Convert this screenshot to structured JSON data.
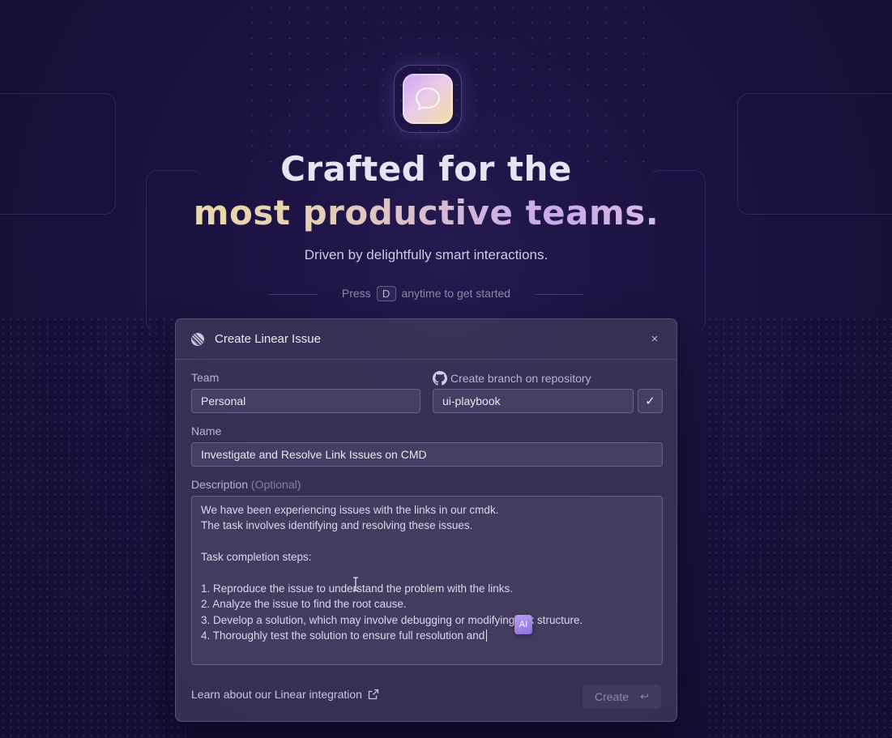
{
  "hero": {
    "title_line1": "Crafted for the",
    "title_line2": "most productive teams.",
    "subtitle": "Driven by delightfully smart interactions.",
    "press_prefix": "Press",
    "press_key": "D",
    "press_suffix": "anytime to get started"
  },
  "dialog": {
    "title": "Create Linear Issue",
    "close_glyph": "×",
    "team": {
      "label": "Team",
      "value": "Personal"
    },
    "repo": {
      "label": "Create branch on repository",
      "value": "ui-playbook",
      "checked": true,
      "check_glyph": "✓"
    },
    "name": {
      "label": "Name",
      "value": "Investigate and Resolve Link Issues on CMD"
    },
    "description": {
      "label": "Description",
      "optional": "(Optional)",
      "lines": [
        "We have been experiencing issues with the links in our cmdk.",
        "The task involves identifying and resolving these issues.",
        "",
        "Task completion steps:",
        "",
        "1. Reproduce the issue to understand the problem with the links.",
        "2. Analyze the issue to find the root cause.",
        "3. Develop a solution, which may involve debugging or modifying link structure.",
        "4. Thoroughly test the solution to ensure full resolution and"
      ]
    },
    "ai_badge": "AI",
    "footer_link": "Learn about our Linear integration",
    "create_label": "Create",
    "create_shortcut": "↩"
  },
  "colors": {
    "background": "#1a1240",
    "dialog_bg": "#3c3458",
    "accent_gradient_start": "#efe1a8",
    "accent_gradient_mid": "#c9a8ee"
  }
}
